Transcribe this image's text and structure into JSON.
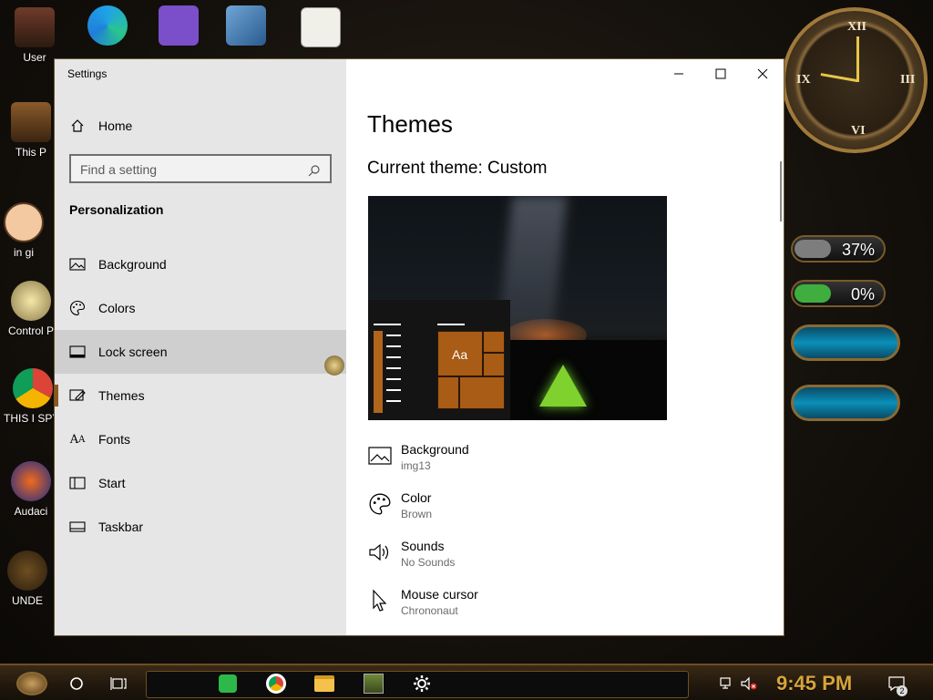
{
  "desktop": {
    "icons": [
      {
        "label": "User",
        "name": "user-desktop-icon"
      },
      {
        "label": "This P",
        "name": "this-pc-desktop-icon"
      },
      {
        "label": "in gi",
        "name": "cartoon-desktop-icon"
      },
      {
        "label": "Control P",
        "name": "control-panel-desktop-icon"
      },
      {
        "label": "THIS I SPYWA",
        "name": "chrome-desktop-icon"
      },
      {
        "label": "Audaci",
        "name": "audacity-desktop-icon"
      },
      {
        "label": "UNDE",
        "name": "under-desktop-icon"
      }
    ],
    "meters": [
      {
        "label": "37%",
        "fraction": 0.37,
        "color": "#7d7d7d"
      },
      {
        "label": "0%",
        "fraction": 0.0,
        "color": "#3fae3f"
      }
    ]
  },
  "window": {
    "title": "Settings",
    "minimize_glyph": "—",
    "maximize_glyph": "☐",
    "close_glyph": "✕"
  },
  "nav": {
    "home_label": "Home",
    "search_placeholder": "Find a setting",
    "section_title": "Personalization",
    "items": [
      {
        "label": "Background",
        "icon": "image-icon"
      },
      {
        "label": "Colors",
        "icon": "palette-icon"
      },
      {
        "label": "Lock screen",
        "icon": "lock-screen-icon"
      },
      {
        "label": "Themes",
        "icon": "brush-icon"
      },
      {
        "label": "Fonts",
        "icon": "font-icon"
      },
      {
        "label": "Start",
        "icon": "start-icon"
      },
      {
        "label": "Taskbar",
        "icon": "taskbar-icon"
      }
    ],
    "hovered": "Lock screen",
    "selected": "Themes"
  },
  "content": {
    "page_title": "Themes",
    "current_theme": "Current theme: Custom",
    "preview_sample_text": "Aa",
    "properties": [
      {
        "name": "Background",
        "value": "img13",
        "icon": "image-icon"
      },
      {
        "name": "Color",
        "value": "Brown",
        "icon": "palette-icon"
      },
      {
        "name": "Sounds",
        "value": "No Sounds",
        "icon": "speaker-icon"
      },
      {
        "name": "Mouse cursor",
        "value": "Chrononaut",
        "icon": "cursor-icon"
      }
    ]
  },
  "taskbar": {
    "time": "9:45 PM",
    "notification_count": "2",
    "accent": "#d6a43a"
  }
}
